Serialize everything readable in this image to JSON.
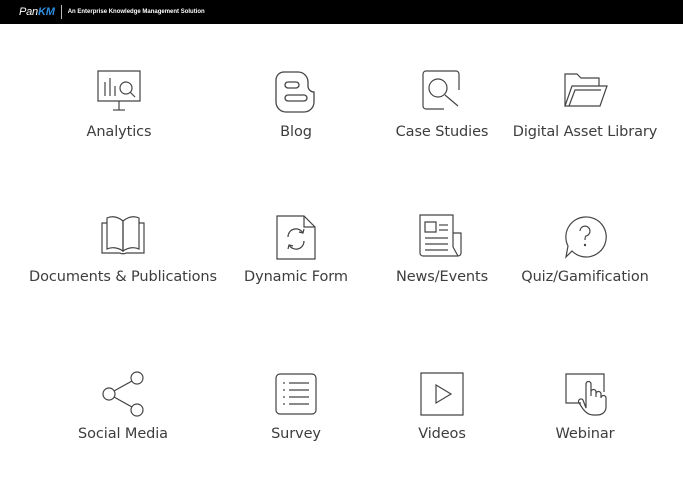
{
  "header": {
    "logo_prefix": "Pan",
    "logo_suffix": "KM",
    "tagline": "An Enterprise Knowledge Management Solution"
  },
  "tiles": [
    {
      "label": "Analytics",
      "icon": "analytics-icon"
    },
    {
      "label": "Blog",
      "icon": "blog-icon"
    },
    {
      "label": "Case Studies",
      "icon": "case-studies-icon"
    },
    {
      "label": "Digital Asset Library",
      "icon": "folder-icon"
    },
    {
      "label": "Documents & Publications",
      "icon": "book-icon"
    },
    {
      "label": "Dynamic Form",
      "icon": "dynamic-form-icon"
    },
    {
      "label": "News/Events",
      "icon": "newspaper-icon"
    },
    {
      "label": "Quiz/Gamification",
      "icon": "question-bubble-icon"
    },
    {
      "label": "Social Media",
      "icon": "share-icon"
    },
    {
      "label": "Survey",
      "icon": "list-icon"
    },
    {
      "label": "Videos",
      "icon": "play-icon"
    },
    {
      "label": "Webinar",
      "icon": "touch-screen-icon"
    }
  ]
}
